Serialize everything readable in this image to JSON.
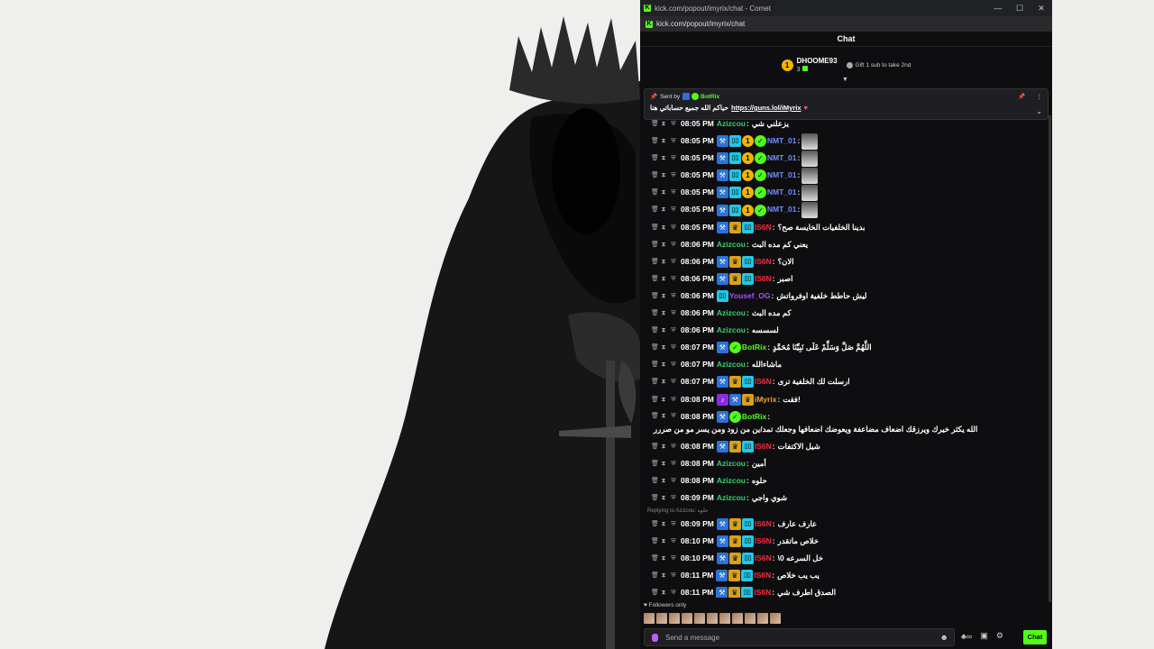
{
  "window": {
    "title": "kick.com/popout/imyrix/chat - Comet",
    "url": "kick.com/popout/imyrix/chat",
    "controls": [
      "—",
      "☐",
      "✕"
    ]
  },
  "chat_header": "Chat",
  "leaderboard": {
    "rank": "1",
    "name": "DHOOME93",
    "count": "3",
    "gift_text": "Gift 1 sub to take 2nd"
  },
  "pinned": {
    "sent_by_label": "Sent by",
    "sender": "BotRix",
    "message": "حياكم الله جميع حساباتي هنا",
    "link": "https://guns.lol/iMyrix",
    "heart": "♥"
  },
  "messages": [
    {
      "time": "08:05 PM",
      "user": "Azizcou",
      "color": "#2fd46b",
      "badges": [],
      "text": "يزعلني شي",
      "partial": true
    },
    {
      "time": "08:05 PM",
      "user": "NMT_01",
      "color": "#6f8cff",
      "badges": [
        "blue",
        "cyan",
        "coin",
        "green"
      ],
      "text": "",
      "avatar": true
    },
    {
      "time": "08:05 PM",
      "user": "NMT_01",
      "color": "#6f8cff",
      "badges": [
        "blue",
        "cyan",
        "coin",
        "green"
      ],
      "text": "",
      "avatar": true
    },
    {
      "time": "08:05 PM",
      "user": "NMT_01",
      "color": "#6f8cff",
      "badges": [
        "blue",
        "cyan",
        "coin",
        "green"
      ],
      "text": "",
      "avatar": true
    },
    {
      "time": "08:05 PM",
      "user": "NMT_01",
      "color": "#6f8cff",
      "badges": [
        "blue",
        "cyan",
        "coin",
        "green"
      ],
      "text": "",
      "avatar": true
    },
    {
      "time": "08:05 PM",
      "user": "NMT_01",
      "color": "#6f8cff",
      "badges": [
        "blue",
        "cyan",
        "coin",
        "green"
      ],
      "text": "",
      "avatar": true
    },
    {
      "time": "08:05 PM",
      "user": "IS6N",
      "color": "#ff2a3c",
      "badges": [
        "blue",
        "gold",
        "cyan"
      ],
      "text": "بدينا الخلفيات الخايسة صح؟"
    },
    {
      "time": "08:06 PM",
      "user": "Azizcou",
      "color": "#2fd46b",
      "badges": [],
      "text": "يعني كم مده البث"
    },
    {
      "time": "08:06 PM",
      "user": "IS6N",
      "color": "#ff2a3c",
      "badges": [
        "blue",
        "gold",
        "cyan"
      ],
      "text": "الان؟"
    },
    {
      "time": "08:06 PM",
      "user": "IS6N",
      "color": "#ff2a3c",
      "badges": [
        "blue",
        "gold",
        "cyan"
      ],
      "text": "اصبر"
    },
    {
      "time": "08:06 PM",
      "user": "Yousef_OG",
      "color": "#b04cff",
      "badges": [
        "cyan"
      ],
      "text": "ليش حاطط خلفية اوفرواتش"
    },
    {
      "time": "08:06 PM",
      "user": "Azizcou",
      "color": "#2fd46b",
      "badges": [],
      "text": "كم مده البث"
    },
    {
      "time": "08:06 PM",
      "user": "Azizcou",
      "color": "#2fd46b",
      "badges": [],
      "text": "لسسسه"
    },
    {
      "time": "08:07 PM",
      "user": "BotRix",
      "color": "#53fc18",
      "badges": [
        "blue",
        "green"
      ],
      "text": "اللَّهُمَّ صَلِّ وَسَلِّمْ عَلَى نَبِيِّنَا مُحَمَّدٍ"
    },
    {
      "time": "08:07 PM",
      "user": "Azizcou",
      "color": "#2fd46b",
      "badges": [],
      "text": "ماشاءالله"
    },
    {
      "time": "08:07 PM",
      "user": "IS6N",
      "color": "#ff2a3c",
      "badges": [
        "blue",
        "gold",
        "cyan"
      ],
      "text": "ارسلت لك الخلفية ترى"
    },
    {
      "time": "08:08 PM",
      "user": "iMyrix",
      "color": "#f5a623",
      "badges": [
        "purple",
        "blue",
        "gold"
      ],
      "text": "فقت!"
    },
    {
      "time": "08:08 PM",
      "user": "BotRix",
      "color": "#53fc18",
      "badges": [
        "blue",
        "green"
      ],
      "text": "الله يكثر خيرك ويرزقك اضعاف مضاعفة ويعوضك اضعافها وجعلك تمد/ين من زود ومن يسر مو من صررر",
      "wrap": true
    },
    {
      "time": "08:08 PM",
      "user": "IS6N",
      "color": "#ff2a3c",
      "badges": [
        "blue",
        "gold",
        "cyan"
      ],
      "text": "شيل الاكتفات"
    },
    {
      "time": "08:08 PM",
      "user": "Azizcou",
      "color": "#2fd46b",
      "badges": [],
      "text": "أمين"
    },
    {
      "time": "08:08 PM",
      "user": "Azizcou",
      "color": "#2fd46b",
      "badges": [],
      "text": "حلوه"
    },
    {
      "time": "08:09 PM",
      "user": "Azizcou",
      "color": "#2fd46b",
      "badges": [],
      "text": "شوي واجي"
    },
    {
      "reply_to": "Replying to Azizcou: حلوه"
    },
    {
      "time": "08:09 PM",
      "user": "IS6N",
      "color": "#ff2a3c",
      "badges": [
        "blue",
        "gold",
        "cyan"
      ],
      "text": "عارف عارف"
    },
    {
      "time": "08:10 PM",
      "user": "IS6N",
      "color": "#ff2a3c",
      "badges": [
        "blue",
        "gold",
        "cyan"
      ],
      "text": "خلاص ماتقدر"
    },
    {
      "time": "08:10 PM",
      "user": "IS6N",
      "color": "#ff2a3c",
      "badges": [
        "blue",
        "gold",
        "cyan"
      ],
      "text": "\\خل السرعه 0"
    },
    {
      "time": "08:11 PM",
      "user": "IS6N",
      "color": "#ff2a3c",
      "badges": [
        "blue",
        "gold",
        "cyan"
      ],
      "text": "يب يب خلاص"
    },
    {
      "time": "08:11 PM",
      "user": "IS6N",
      "color": "#ff2a3c",
      "badges": [
        "blue",
        "gold",
        "cyan"
      ],
      "text": "الصدق اطرف شي"
    }
  ],
  "followers_only": "Followers only",
  "input": {
    "placeholder": "Send a message"
  },
  "send_button": "Chat"
}
